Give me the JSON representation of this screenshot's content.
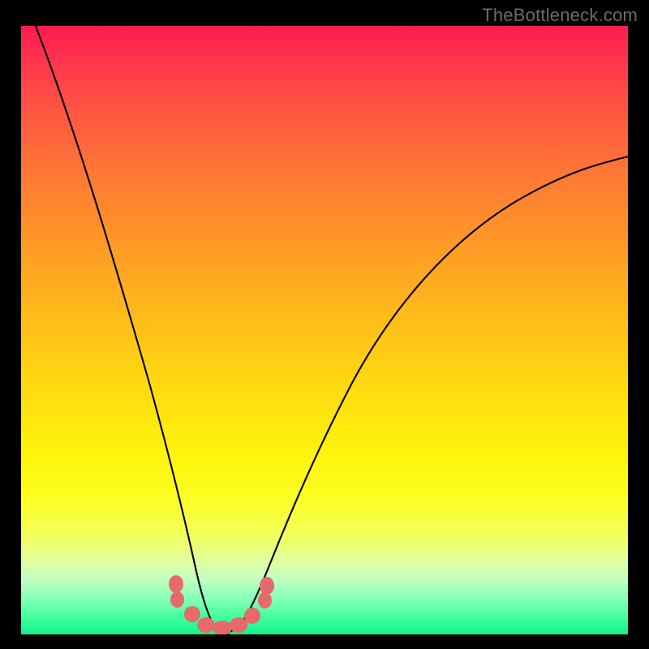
{
  "watermark": "TheBottleneck.com",
  "colors": {
    "frame": "#000000",
    "curve": "#000000",
    "blob": "#e66a6a",
    "gradient_top": "#ff1b52",
    "gradient_bottom": "#11f28d"
  },
  "chart_data": {
    "type": "line",
    "title": "",
    "xlabel": "",
    "ylabel": "",
    "xlim": [
      0,
      100
    ],
    "ylim": [
      0,
      100
    ],
    "grid": false,
    "legend": false,
    "annotations": [
      "TheBottleneck.com"
    ],
    "series": [
      {
        "name": "curve",
        "x": [
          0,
          4,
          8,
          12,
          15,
          18,
          21,
          24,
          27,
          29,
          30,
          31,
          32,
          34,
          36,
          38,
          40,
          44,
          48,
          54,
          60,
          68,
          76,
          84,
          92,
          100
        ],
        "values": [
          100,
          88,
          76,
          64,
          54,
          44,
          35,
          26,
          17,
          11,
          7,
          2,
          0,
          0,
          0,
          2,
          6,
          14,
          22,
          32,
          42,
          52,
          59,
          66,
          71,
          75
        ]
      }
    ],
    "highlight_blobs_x": [
      25,
      26,
      29,
      30,
      31,
      32,
      33,
      34,
      37,
      38
    ]
  }
}
